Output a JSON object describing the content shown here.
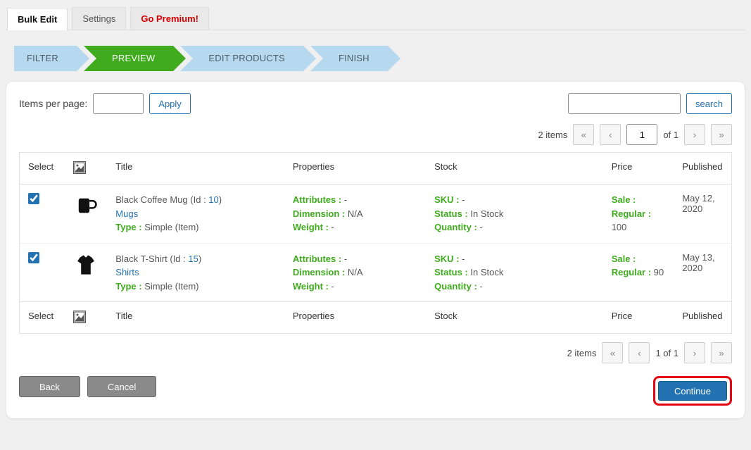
{
  "tabs": {
    "bulk_edit": "Bulk Edit",
    "settings": "Settings",
    "go_premium": "Go Premium!"
  },
  "wizard": {
    "filter": "FILTER",
    "preview": "PREVIEW",
    "edit_products": "EDIT PRODUCTS",
    "finish": "FINISH"
  },
  "toolbar": {
    "items_per_page_label": "Items per page:",
    "items_per_page_value": "",
    "apply_label": "Apply",
    "search_value": "",
    "search_label": "search"
  },
  "pagination_top": {
    "count_text": "2 items",
    "first": "«",
    "prev": "‹",
    "page_value": "1",
    "of_text": "of 1",
    "next": "›",
    "last": "»"
  },
  "pagination_bottom": {
    "count_text": "2 items",
    "first": "«",
    "prev": "‹",
    "page_text": "1 of 1",
    "next": "›",
    "last": "»"
  },
  "columns": {
    "select": "Select",
    "title": "Title",
    "properties": "Properties",
    "stock": "Stock",
    "price": "Price",
    "published": "Published"
  },
  "labels": {
    "id_prefix": "(Id : ",
    "id_suffix": ")",
    "type_label": "Type : ",
    "attributes_label": "Attributes : ",
    "dimension_label": "Dimension : ",
    "weight_label": "Weight : ",
    "sku_label": "SKU : ",
    "status_label": "Status : ",
    "quantity_label": "Quantity : ",
    "sale_label": "Sale :",
    "regular_label": "Regular : "
  },
  "rows": [
    {
      "checked": true,
      "thumb": "mug",
      "title": "Black Coffee Mug",
      "id": "10",
      "category": "Mugs",
      "type_value": "Simple (Item)",
      "attributes": "-",
      "dimension": "N/A",
      "weight": "-",
      "sku": "-",
      "status": "In Stock",
      "quantity": "-",
      "sale": "",
      "regular": "100",
      "published": "May 12, 2020"
    },
    {
      "checked": true,
      "thumb": "tshirt",
      "title": "Black T-Shirt",
      "id": "15",
      "category": "Shirts",
      "type_value": "Simple (Item)",
      "attributes": "-",
      "dimension": "N/A",
      "weight": "-",
      "sku": "-",
      "status": "In Stock",
      "quantity": "-",
      "sale": "",
      "regular": "90",
      "published": "May 13, 2020"
    }
  ],
  "footer": {
    "back": "Back",
    "cancel": "Cancel",
    "continue": "Continue"
  }
}
